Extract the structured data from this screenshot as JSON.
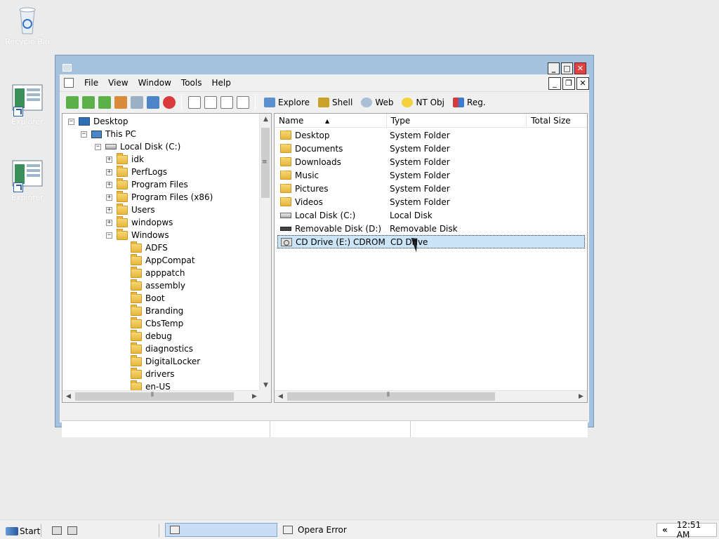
{
  "desktop": {
    "icons": [
      {
        "name": "Recycle Bin"
      },
      {
        "name": "Explorer"
      },
      {
        "name": "Explorer"
      }
    ]
  },
  "window": {
    "menu": [
      "File",
      "View",
      "Window",
      "Tools",
      "Help"
    ],
    "toolbar_buttons": [
      {
        "label": "Explore",
        "icon": "folder-window-icon"
      },
      {
        "label": "Shell",
        "icon": "shell-icon"
      },
      {
        "label": "Web",
        "icon": "globe-icon"
      },
      {
        "label": "NT Obj",
        "icon": "nt-object-icon"
      },
      {
        "label": "Reg.",
        "icon": "registry-icon"
      }
    ],
    "tree": [
      {
        "label": "Desktop",
        "level": 0,
        "icon": "desktop",
        "exp": "−"
      },
      {
        "label": "This PC",
        "level": 1,
        "icon": "pc",
        "exp": "−"
      },
      {
        "label": "Local Disk (C:)",
        "level": 2,
        "icon": "disk",
        "exp": "−"
      },
      {
        "label": "idk",
        "level": 3,
        "icon": "folder",
        "exp": "+"
      },
      {
        "label": "PerfLogs",
        "level": 3,
        "icon": "folder",
        "exp": "+"
      },
      {
        "label": "Program Files",
        "level": 3,
        "icon": "folder",
        "exp": "+"
      },
      {
        "label": "Program Files (x86)",
        "level": 3,
        "icon": "folder",
        "exp": "+"
      },
      {
        "label": "Users",
        "level": 3,
        "icon": "folder",
        "exp": "+"
      },
      {
        "label": "windopws",
        "level": 3,
        "icon": "folder",
        "exp": "+"
      },
      {
        "label": "Windows",
        "level": 3,
        "icon": "folder",
        "exp": "−"
      },
      {
        "label": "ADFS",
        "level": 4,
        "icon": "folder",
        "exp": ""
      },
      {
        "label": "AppCompat",
        "level": 4,
        "icon": "folder",
        "exp": ""
      },
      {
        "label": "apppatch",
        "level": 4,
        "icon": "folder",
        "exp": ""
      },
      {
        "label": "assembly",
        "level": 4,
        "icon": "folder",
        "exp": ""
      },
      {
        "label": "Boot",
        "level": 4,
        "icon": "folder",
        "exp": ""
      },
      {
        "label": "Branding",
        "level": 4,
        "icon": "folder",
        "exp": ""
      },
      {
        "label": "CbsTemp",
        "level": 4,
        "icon": "folder",
        "exp": ""
      },
      {
        "label": "debug",
        "level": 4,
        "icon": "folder",
        "exp": ""
      },
      {
        "label": "diagnostics",
        "level": 4,
        "icon": "folder",
        "exp": ""
      },
      {
        "label": "DigitalLocker",
        "level": 4,
        "icon": "folder",
        "exp": ""
      },
      {
        "label": "drivers",
        "level": 4,
        "icon": "folder",
        "exp": ""
      },
      {
        "label": "en-US",
        "level": 4,
        "icon": "folder",
        "exp": ""
      }
    ],
    "columns": [
      "Name",
      "Type",
      "Total Size"
    ],
    "items": [
      {
        "name": "Desktop",
        "type": "System Folder",
        "icon": "folder"
      },
      {
        "name": "Documents",
        "type": "System Folder",
        "icon": "folder"
      },
      {
        "name": "Downloads",
        "type": "System Folder",
        "icon": "folder"
      },
      {
        "name": "Music",
        "type": "System Folder",
        "icon": "folder"
      },
      {
        "name": "Pictures",
        "type": "System Folder",
        "icon": "folder"
      },
      {
        "name": "Videos",
        "type": "System Folder",
        "icon": "folder"
      },
      {
        "name": "Local Disk (C:)",
        "type": "Local Disk",
        "icon": "disk"
      },
      {
        "name": "Removable Disk (D:)",
        "type": "Removable Disk",
        "icon": "removable"
      },
      {
        "name": "CD Drive (E:) CDROM",
        "type": "CD Drive",
        "icon": "cd",
        "selected": true
      }
    ]
  },
  "taskbar": {
    "start_label": "Start",
    "tasks": [
      {
        "label": "",
        "active": true
      },
      {
        "label": "Opera Error",
        "active": false
      }
    ],
    "clock": "12:51 AM",
    "tray_chevron": "«"
  }
}
